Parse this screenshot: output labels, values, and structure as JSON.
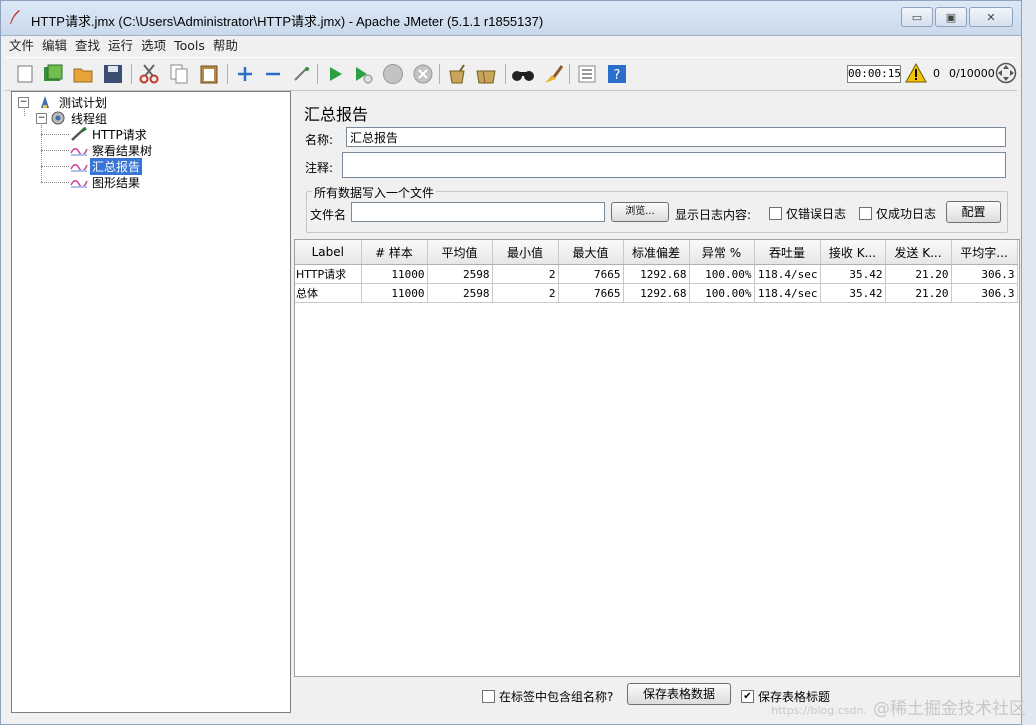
{
  "window": {
    "title": "HTTP请求.jmx (C:\\Users\\Administrator\\HTTP请求.jmx) - Apache JMeter (5.1.1 r1855137)",
    "minimize": "▭",
    "maximize": "▣",
    "close": "✕"
  },
  "menu": [
    "文件",
    "编辑",
    "查找",
    "运行",
    "选项",
    "Tools",
    "帮助"
  ],
  "toolbar": {
    "timer": "00:00:15",
    "error_count": "0",
    "thread_count": "0/10000"
  },
  "tree": {
    "items": [
      {
        "label": "测试计划",
        "icon": "test-plan-icon"
      },
      {
        "label": "线程组",
        "icon": "thread-group-icon"
      },
      {
        "label": "HTTP请求",
        "icon": "http-sampler-icon"
      },
      {
        "label": "察看结果树",
        "icon": "listener-icon"
      },
      {
        "label": "汇总报告",
        "icon": "listener-icon",
        "selected": true
      },
      {
        "label": "图形结果",
        "icon": "listener-icon"
      }
    ]
  },
  "panel": {
    "title": "汇总报告",
    "name_label": "名称:",
    "name_value": "汇总报告",
    "comment_label": "注释:",
    "comment_value": "",
    "file_group_title": "所有数据写入一个文件",
    "filename_label": "文件名",
    "filename_value": "",
    "browse_button": "浏览...",
    "log_content_label": "显示日志内容:",
    "errors_only_label": "仅错误日志",
    "success_only_label": "仅成功日志",
    "configure_button": "配置"
  },
  "table": {
    "headers": [
      "Label",
      "# 样本",
      "平均值",
      "最小值",
      "最大值",
      "标准偏差",
      "异常 %",
      "吞吐量",
      "接收 K...",
      "发送 K...",
      "平均字..."
    ],
    "rows": [
      [
        "HTTP请求",
        "11000",
        "2598",
        "2",
        "7665",
        "1292.68",
        "100.00%",
        "118.4/sec",
        "35.42",
        "21.20",
        "306.3"
      ],
      [
        "总体",
        "11000",
        "2598",
        "2",
        "7665",
        "1292.68",
        "100.00%",
        "118.4/sec",
        "35.42",
        "21.20",
        "306.3"
      ]
    ]
  },
  "bottom": {
    "include_group_label": "在标签中包含组名称?",
    "save_table_button": "保存表格数据",
    "save_header_label": "保存表格标题",
    "save_header_checked": true
  },
  "watermark": {
    "small": "https://blog.csdn.",
    "main": "@稀土掘金技术社区"
  }
}
